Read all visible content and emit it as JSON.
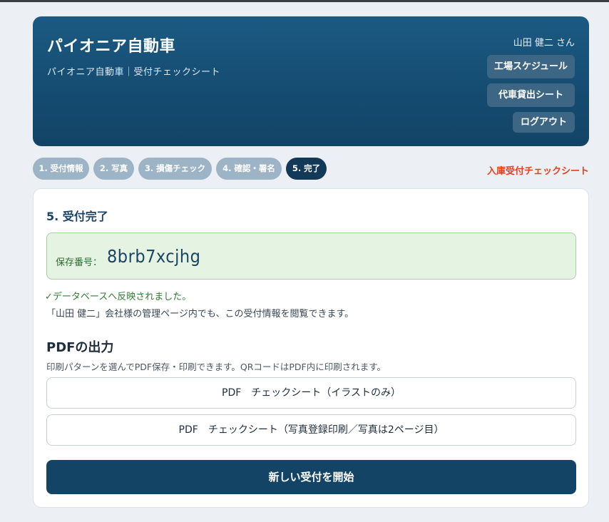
{
  "header": {
    "title": "パイオニア自動車",
    "subtitle": "パイオニア自動車｜受付チェックシート",
    "user": "山田 健二 さん",
    "buttons": {
      "factory_schedule": "工場スケジュール",
      "loaner_sheet": "代車貸出シート",
      "logout": "ログアウト"
    }
  },
  "steps": [
    {
      "label": "1. 受付情報",
      "active": false
    },
    {
      "label": "2. 写真",
      "active": false
    },
    {
      "label": "3. 損傷チェック",
      "active": false
    },
    {
      "label": "4. 確認・署名",
      "active": false
    },
    {
      "label": "5. 完了",
      "active": true
    }
  ],
  "page_tag": "入庫受付チェックシート",
  "complete": {
    "title": "5. 受付完了",
    "save_label": "保存番号：",
    "save_number": "8brb7xcjhg",
    "db_message": "✓データベースへ反映されました。",
    "info_message": "「山田 健二」会社様の管理ページ内でも、この受付情報を閲覧できます。"
  },
  "pdf": {
    "title": "PDFの出力",
    "description": "印刷パターンを選んでPDF保存・印刷できます。QRコードはPDF内に印刷されます。",
    "illustration_button": "PDF　チェックシート（イラストのみ）",
    "photo_button": "PDF　チェックシート（写真登録印刷／写真は2ページ目）"
  },
  "new_reception_button": "新しい受付を開始",
  "colors": {
    "header_bg": "#154b70",
    "step_inactive": "#9db3c6",
    "step_active": "#123a58",
    "accent_tag": "#e8401c",
    "success_bg": "#e5f3e2",
    "primary": "#134466"
  }
}
